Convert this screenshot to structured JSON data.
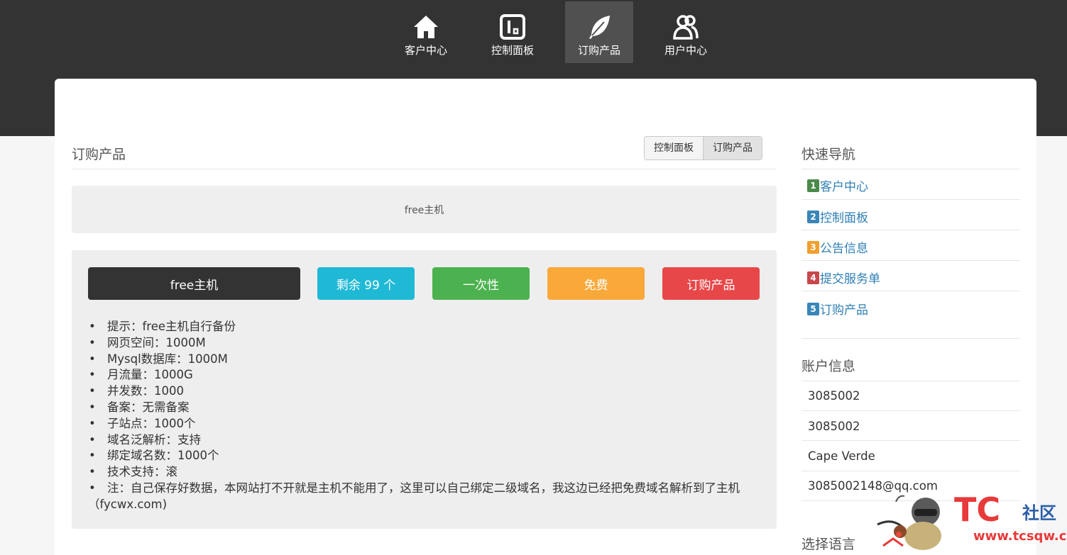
{
  "nav": {
    "items": [
      {
        "label": "客户中心",
        "icon": "home-icon"
      },
      {
        "label": "控制面板",
        "icon": "panel-icon"
      },
      {
        "label": "订购产品",
        "icon": "feather-icon"
      },
      {
        "label": "用户中心",
        "icon": "users-icon"
      }
    ],
    "active": "订购产品"
  },
  "page": {
    "title": "订购产品",
    "breadcrumb": [
      "控制面板",
      "订购产品"
    ]
  },
  "product": {
    "name": "free主机",
    "badges": {
      "name": "free主机",
      "stock": "剩余 99 个",
      "cycle": "一次性",
      "price": "免费",
      "order": "订购产品"
    },
    "features": [
      "提示：free主机自行备份",
      "网页空间：1000M",
      "Mysql数据库：1000M",
      "月流量：1000G",
      "并发数：1000",
      "备案：无需备案",
      "子站点：1000个",
      "域名泛解析：支持",
      "绑定域名数：1000个",
      "技术支持：滚",
      "注：自己保存好数据，本网站打不开就是主机不能用了，这里可以自己绑定二级域名，我这边已经把免费域名解析到了主机（fycwx.com)"
    ]
  },
  "sidebar": {
    "quick_nav_title": "快速导航",
    "quick_nav": [
      {
        "num": "1",
        "label": "客户中心",
        "color": "#4a8a4a"
      },
      {
        "num": "2",
        "label": "控制面板",
        "color": "#3a86b8"
      },
      {
        "num": "3",
        "label": "公告信息",
        "color": "#f0a030"
      },
      {
        "num": "4",
        "label": "提交服务单",
        "color": "#c8474a"
      },
      {
        "num": "5",
        "label": "订购产品",
        "color": "#3a86b8"
      }
    ],
    "account_title": "账户信息",
    "account": [
      "3085002",
      "3085002",
      "Cape Verde",
      "3085002148@qq.com"
    ],
    "language_title": "选择语言"
  },
  "watermark": {
    "logo": "TC",
    "site": "社区",
    "url": "www.tcsqw.com"
  },
  "colors": {
    "topbar": "#333333",
    "stock": "#1fb9d6",
    "cycle": "#4cb24f",
    "price": "#f8a93a",
    "order": "#e84749",
    "link": "#2f7fb5"
  }
}
